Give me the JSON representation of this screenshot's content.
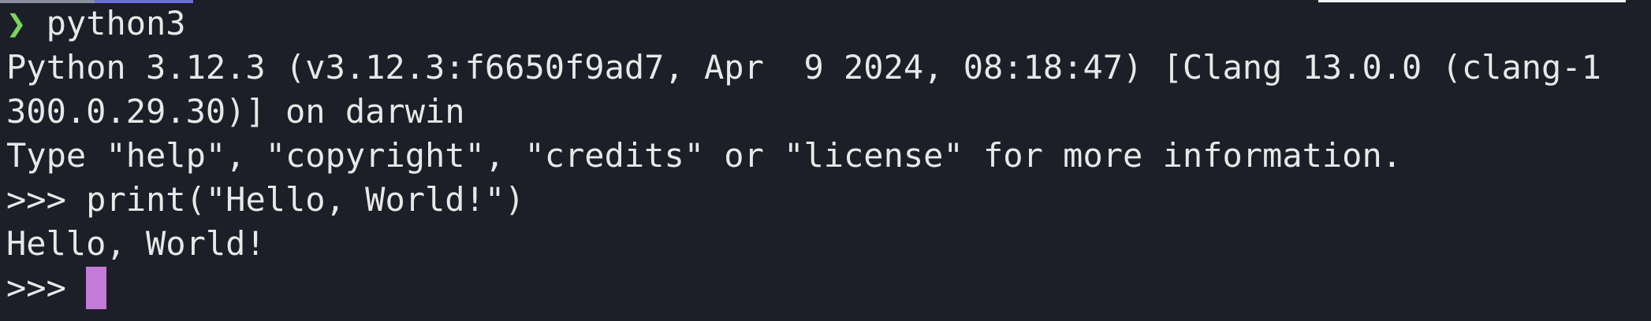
{
  "terminal": {
    "shell_prompt_symbol": "❯",
    "shell_command": " python3",
    "banner_line_1": "Python 3.12.3 (v3.12.3:f6650f9ad7, Apr  9 2024, 08:18:47) [Clang 13.0.0 (clang-1",
    "banner_line_2": "300.0.29.30)] on darwin",
    "help_line": "Type \"help\", \"copyright\", \"credits\" or \"license\" for more information.",
    "repl_prompt_1": ">>> ",
    "repl_input_1": "print(\"Hello, World!\")",
    "output_1": "Hello, World!",
    "repl_prompt_2": ">>> "
  },
  "colors": {
    "background": "#1c1f27",
    "text": "#e8e8e8",
    "prompt_arrow": "#7bd45a",
    "cursor": "#c47ad6"
  }
}
